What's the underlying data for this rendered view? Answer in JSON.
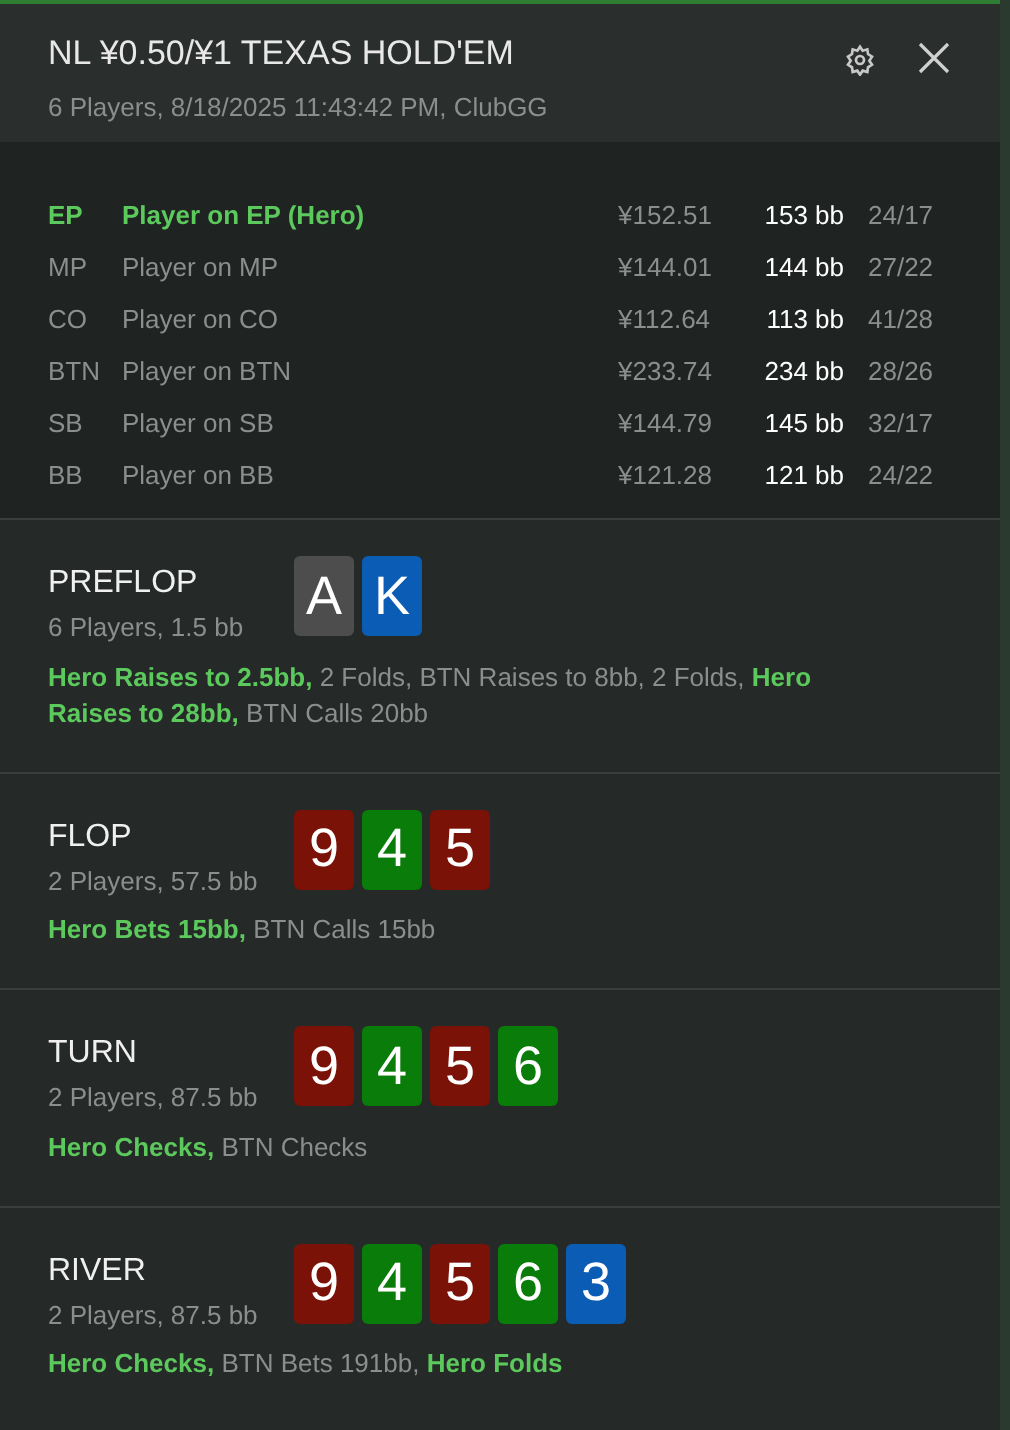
{
  "window": {
    "title": "NL ¥0.50/¥1 TEXAS HOLD'EM",
    "subtitle": "6 Players, 8/18/2025 11:43:42 PM, ClubGG"
  },
  "players": [
    {
      "position": "EP",
      "name": "Player on EP (Hero)",
      "hero": true,
      "stack": "¥152.51",
      "bb": "153 bb",
      "stats": "24/17"
    },
    {
      "position": "MP",
      "name": "Player on MP",
      "hero": false,
      "stack": "¥144.01",
      "bb": "144 bb",
      "stats": "27/22"
    },
    {
      "position": "CO",
      "name": "Player on CO",
      "hero": false,
      "stack": "¥112.64",
      "bb": "113 bb",
      "stats": "41/28"
    },
    {
      "position": "BTN",
      "name": "Player on BTN",
      "hero": false,
      "stack": "¥233.74",
      "bb": "234 bb",
      "stats": "28/26"
    },
    {
      "position": "SB",
      "name": "Player on SB",
      "hero": false,
      "stack": "¥144.79",
      "bb": "145 bb",
      "stats": "32/17"
    },
    {
      "position": "BB",
      "name": "Player on BB",
      "hero": false,
      "stack": "¥121.28",
      "bb": "121 bb",
      "stats": "24/22"
    }
  ],
  "streets": [
    {
      "name": "PREFLOP",
      "info": "6 Players, 1.5 bb",
      "cards": [
        {
          "rank": "A",
          "color": "#4d4d4d"
        },
        {
          "rank": "K",
          "color": "#0b5cb5"
        }
      ],
      "actions": [
        {
          "text": "Hero Raises to 2.5bb,",
          "hero": true
        },
        {
          "text": "2 Folds, BTN Raises to 8bb, 2 Folds,",
          "hero": false
        },
        {
          "text": "Hero Raises to 28bb,",
          "hero": true
        },
        {
          "text": "BTN Calls 20bb",
          "hero": false
        }
      ]
    },
    {
      "name": "FLOP",
      "info": "2 Players, 57.5 bb",
      "cards": [
        {
          "rank": "9",
          "color": "#7a1208"
        },
        {
          "rank": "4",
          "color": "#0a7c0a"
        },
        {
          "rank": "5",
          "color": "#7a1208"
        }
      ],
      "actions": [
        {
          "text": "Hero Bets 15bb,",
          "hero": true
        },
        {
          "text": "BTN Calls 15bb",
          "hero": false
        }
      ]
    },
    {
      "name": "TURN",
      "info": "2 Players, 87.5 bb",
      "cards": [
        {
          "rank": "9",
          "color": "#7a1208"
        },
        {
          "rank": "4",
          "color": "#0a7c0a"
        },
        {
          "rank": "5",
          "color": "#7a1208"
        },
        {
          "rank": "6",
          "color": "#0a7c0a"
        }
      ],
      "actions": [
        {
          "text": "Hero Checks,",
          "hero": true
        },
        {
          "text": "BTN Checks",
          "hero": false
        }
      ]
    },
    {
      "name": "RIVER",
      "info": "2 Players, 87.5 bb",
      "cards": [
        {
          "rank": "9",
          "color": "#7a1208"
        },
        {
          "rank": "4",
          "color": "#0a7c0a"
        },
        {
          "rank": "5",
          "color": "#7a1208"
        },
        {
          "rank": "6",
          "color": "#0a7c0a"
        },
        {
          "rank": "3",
          "color": "#0b5cb5"
        }
      ],
      "actions": [
        {
          "text": "Hero Checks,",
          "hero": true
        },
        {
          "text": "BTN Bets 191bb,",
          "hero": false
        },
        {
          "text": "Hero Folds",
          "hero": true
        }
      ]
    }
  ]
}
